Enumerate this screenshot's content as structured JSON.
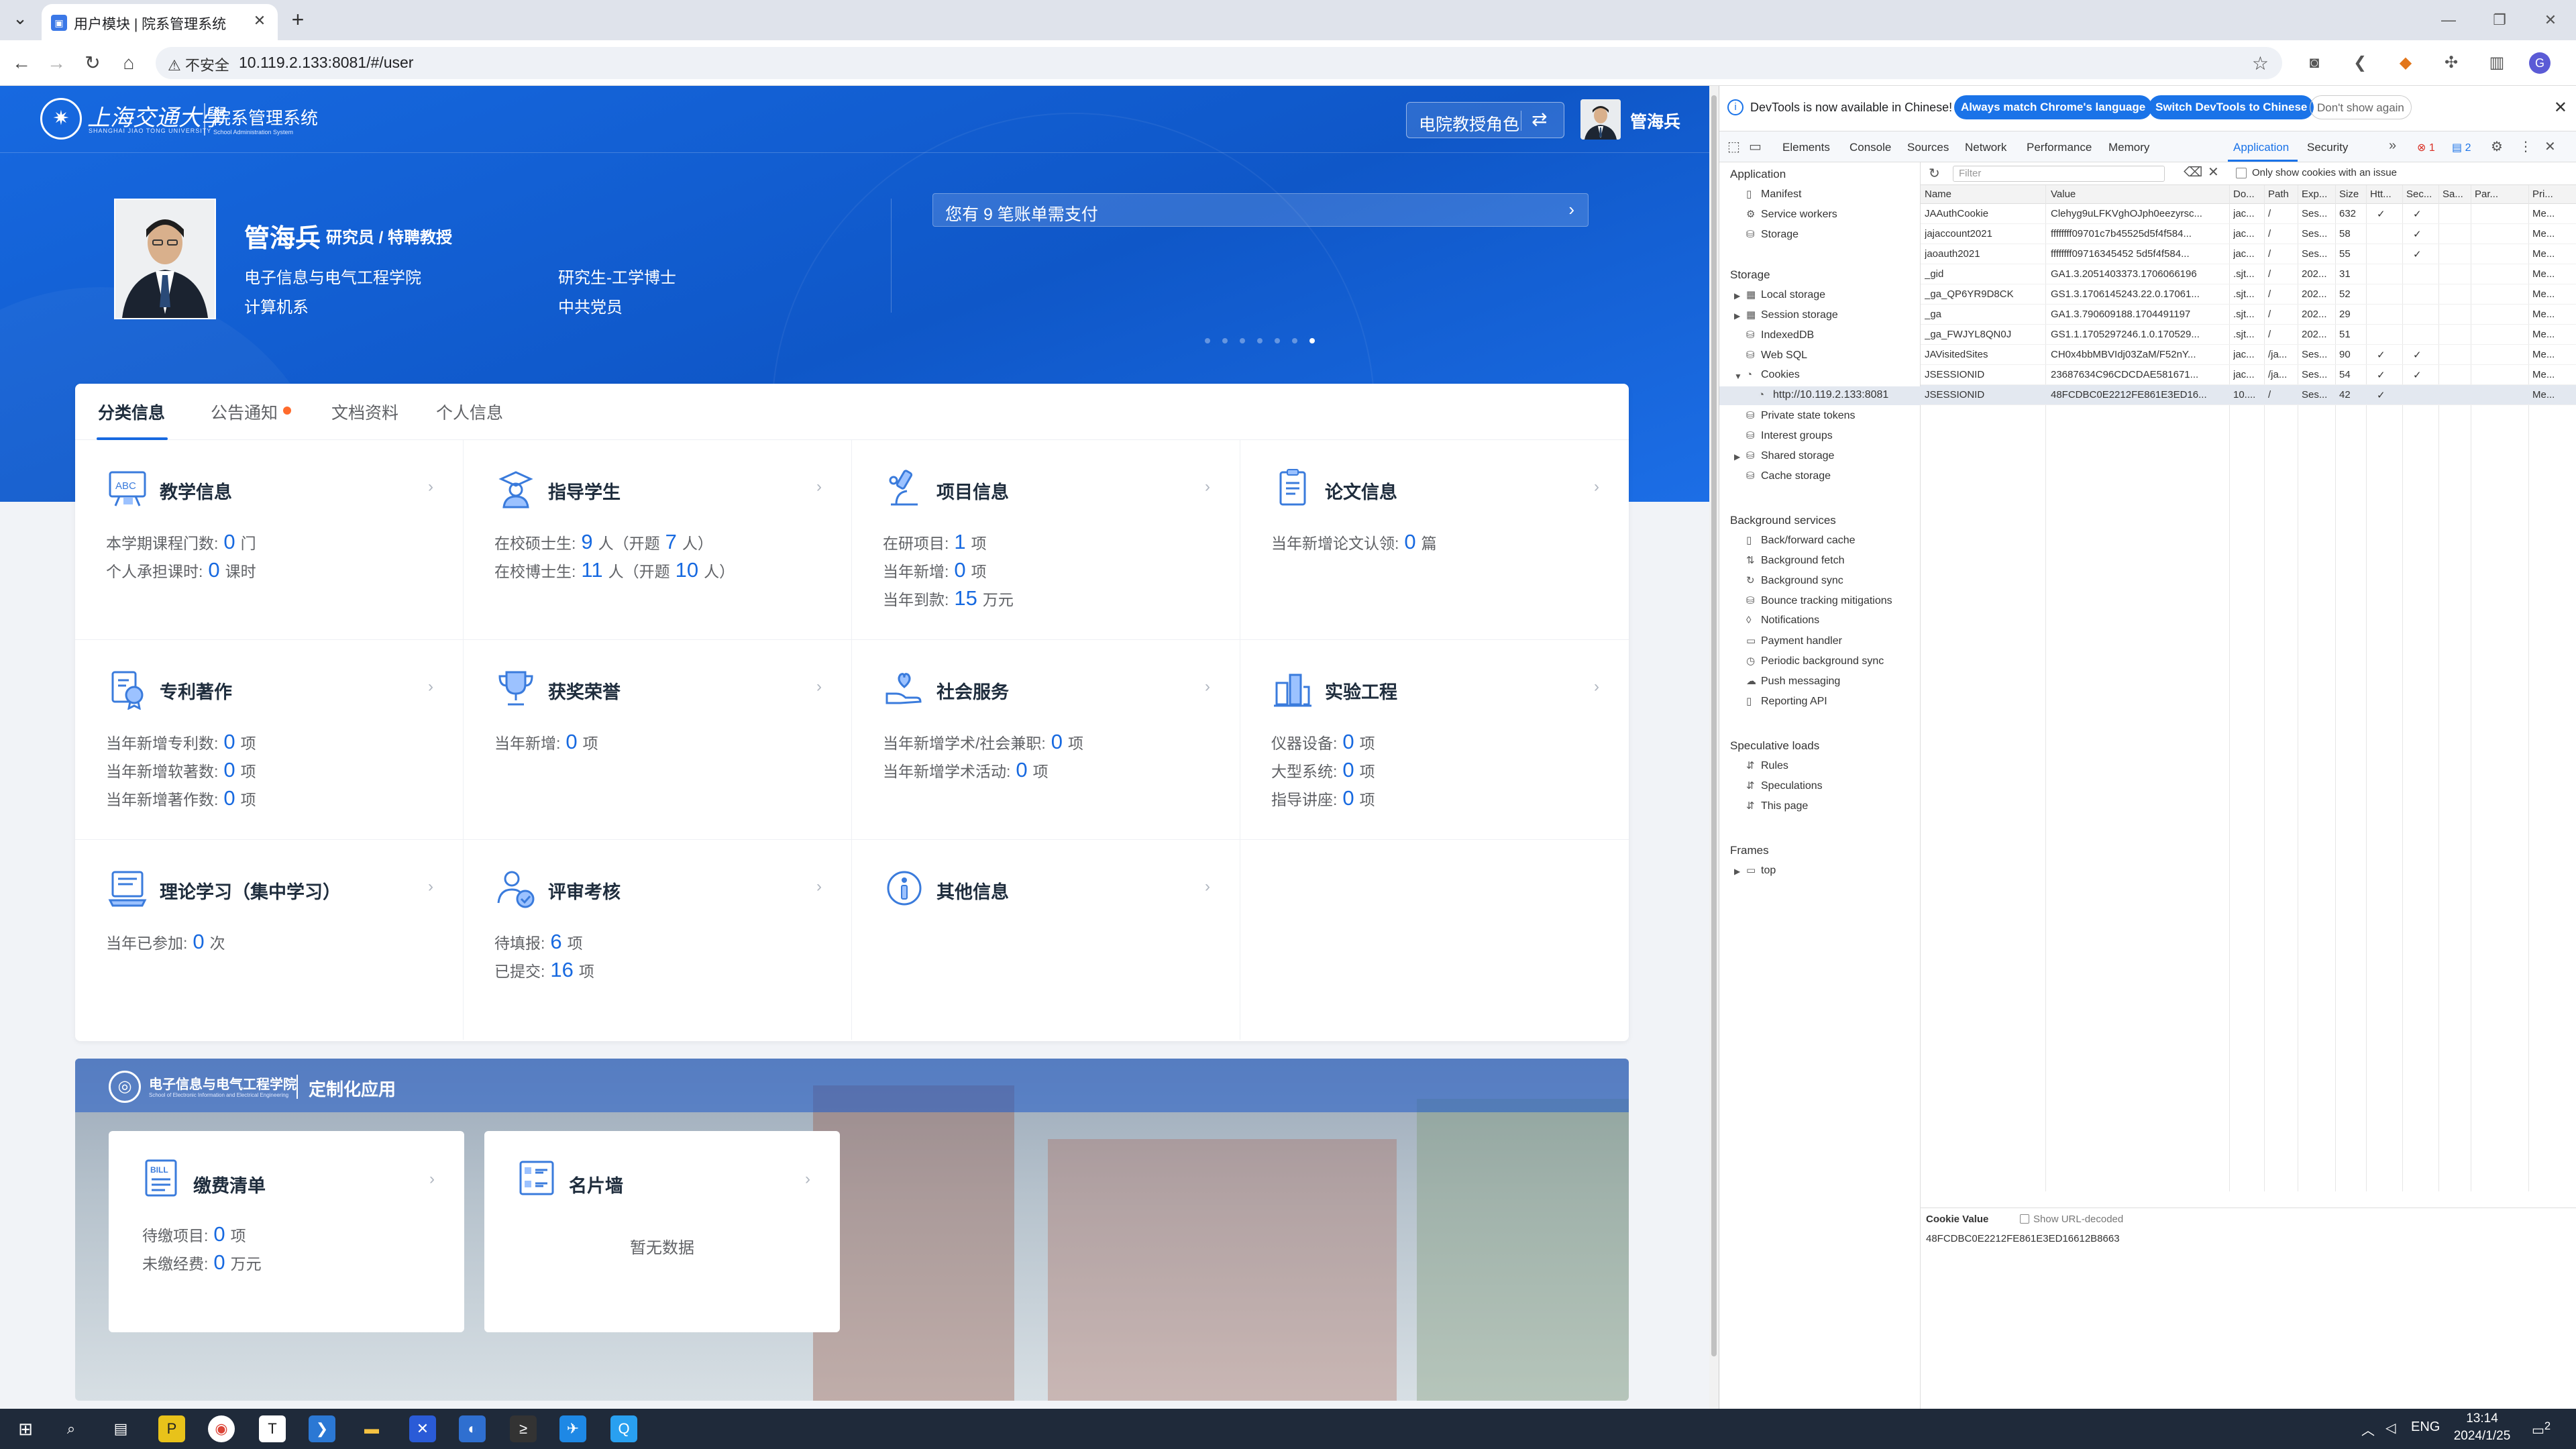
{
  "browser": {
    "tab_title": "用户模块 | 院系管理系统",
    "url": "10.119.2.133:8081/#/user",
    "insecure_label": "不安全"
  },
  "header": {
    "system_title": "院系管理系统",
    "system_subtitle": "School Administration System",
    "university_logo_text": "上海交通大學",
    "university_en": "SHANGHAI JIAO TONG UNIVERSITY",
    "role_button": "电院教授角色",
    "user_name": "管海兵"
  },
  "profile": {
    "name": "管海兵",
    "title": "研究员 / 特聘教授",
    "department": "电子信息与电气工程学院",
    "degree": "研究生-工学博士",
    "major": "计算机系",
    "party": "中共党员"
  },
  "notice": {
    "text": "您有 9 笔账单需支付"
  },
  "tabs": [
    {
      "label": "分类信息"
    },
    {
      "label": "公告通知"
    },
    {
      "label": "文档资料"
    },
    {
      "label": "个人信息"
    }
  ],
  "categories": {
    "teaching": {
      "title": "教学信息",
      "s1_label": "本学期课程门数:",
      "s1_val": "0",
      "s1_unit": "门",
      "s2_label": "个人承担课时:",
      "s2_val": "0",
      "s2_unit": "课时"
    },
    "students": {
      "title": "指导学生",
      "s1_label": "在校硕士生:",
      "s1_val": "9",
      "s1_mid": "人（开题",
      "s1_val2": "7",
      "s1_unit": "人）",
      "s2_label": "在校博士生:",
      "s2_val": "11",
      "s2_mid": "人（开题",
      "s2_val2": "10",
      "s2_unit": "人）"
    },
    "projects": {
      "title": "项目信息",
      "s1_label": "在研项目:",
      "s1_val": "1",
      "s1_unit": "项",
      "s2_label": "当年新增:",
      "s2_val": "0",
      "s2_unit": "项",
      "s3_label": "当年到款:",
      "s3_val": "15",
      "s3_unit": "万元"
    },
    "papers": {
      "title": "论文信息",
      "s1_label": "当年新增论文认领:",
      "s1_val": "0",
      "s1_unit": "篇"
    },
    "patents": {
      "title": "专利著作",
      "s1_label": "当年新增专利数:",
      "s1_val": "0",
      "s1_unit": "项",
      "s2_label": "当年新增软著数:",
      "s2_val": "0",
      "s2_unit": "项",
      "s3_label": "当年新增著作数:",
      "s3_val": "0",
      "s3_unit": "项"
    },
    "awards": {
      "title": "获奖荣誉",
      "s1_label": "当年新增:",
      "s1_val": "0",
      "s1_unit": "项"
    },
    "service": {
      "title": "社会服务",
      "s1_label": "当年新增学术/社会兼职:",
      "s1_val": "0",
      "s1_unit": "项",
      "s2_label": "当年新增学术活动:",
      "s2_val": "0",
      "s2_unit": "项"
    },
    "lab": {
      "title": "实验工程",
      "s1_label": "仪器设备:",
      "s1_val": "0",
      "s1_unit": "项",
      "s2_label": "大型系统:",
      "s2_val": "0",
      "s2_unit": "项",
      "s3_label": "指导讲座:",
      "s3_val": "0",
      "s3_unit": "项"
    },
    "theory": {
      "title": "理论学习（集中学习）",
      "s1_label": "当年已参加:",
      "s1_val": "0",
      "s1_unit": "次"
    },
    "review": {
      "title": "评审考核",
      "s1_label": "待填报:",
      "s1_val": "6",
      "s1_unit": "项",
      "s2_label": "已提交:",
      "s2_val": "16",
      "s2_unit": "项"
    },
    "other": {
      "title": "其他信息"
    }
  },
  "custom_apps": {
    "institute": "电子信息与电气工程学院",
    "institute_en": "School of Electronic Information and Electrical Engineering",
    "title": "定制化应用",
    "bill": {
      "title": "缴费清单",
      "s1_label": "待缴项目:",
      "s1_val": "0",
      "s1_unit": "项",
      "s2_label": "未缴经费:",
      "s2_val": "0",
      "s2_unit": "万元",
      "icon_text": "BILL"
    },
    "cards": {
      "title": "名片墙",
      "empty": "暂无数据"
    }
  },
  "devtools": {
    "info_text": "DevTools is now available in Chinese!",
    "btn_match": "Always match Chrome's language",
    "btn_switch": "Switch DevTools to Chinese",
    "btn_dismiss": "Don't show again",
    "tabs": [
      "Elements",
      "Console",
      "Sources",
      "Network",
      "Performance",
      "Memory",
      "Application",
      "Security"
    ],
    "error_count": "1",
    "msg_count": "2",
    "sidebar": {
      "application": "Application",
      "manifest": "Manifest",
      "service_workers": "Service workers",
      "storage_item": "Storage",
      "storage": "Storage",
      "local_storage": "Local storage",
      "session_storage": "Session storage",
      "indexeddb": "IndexedDB",
      "websql": "Web SQL",
      "cookies": "Cookies",
      "cookie_origin": "http://10.119.2.133:8081",
      "private_state": "Private state tokens",
      "interest_groups": "Interest groups",
      "shared_storage": "Shared storage",
      "cache_storage": "Cache storage",
      "background": "Background services",
      "bfcache": "Back/forward cache",
      "bg_fetch": "Background fetch",
      "bg_sync": "Background sync",
      "bounce": "Bounce tracking mitigations",
      "notifications": "Notifications",
      "payment": "Payment handler",
      "periodic_sync": "Periodic background sync",
      "push": "Push messaging",
      "reporting": "Reporting API",
      "speculative": "Speculative loads",
      "rules": "Rules",
      "speculations": "Speculations",
      "this_page": "This page",
      "frames": "Frames",
      "top": "top"
    },
    "filter_placeholder": "Filter",
    "only_issue": "Only show cookies with an issue",
    "columns": [
      "Name",
      "Value",
      "Do...",
      "Path",
      "Exp...",
      "Size",
      "Htt...",
      "Sec...",
      "Sa...",
      "Par...",
      "Pri..."
    ],
    "cookies": [
      {
        "name": "JAAuthCookie",
        "value": "Clehyg9uLFKVghOJph0eezyrsc...",
        "domain": "jac...",
        "path": "/",
        "exp": "Ses...",
        "size": "632",
        "http": "✓",
        "sec": "✓",
        "pri": "Me..."
      },
      {
        "name": "jajaccount2021",
        "value": "ffffffff09701c7b45525d5f4f584...",
        "domain": "jac...",
        "path": "/",
        "exp": "Ses...",
        "size": "58",
        "http": "",
        "sec": "✓",
        "pri": "Me..."
      },
      {
        "name": "jaoauth2021",
        "value": "ffffffff09716345452 5d5f4f584...",
        "domain": "jac...",
        "path": "/",
        "exp": "Ses...",
        "size": "55",
        "http": "",
        "sec": "✓",
        "pri": "Me..."
      },
      {
        "name": "_gid",
        "value": "GA1.3.2051403373.1706066196",
        "domain": ".sjt...",
        "path": "/",
        "exp": "202...",
        "size": "31",
        "http": "",
        "sec": "",
        "pri": "Me..."
      },
      {
        "name": "_ga_QP6YR9D8CK",
        "value": "GS1.3.1706145243.22.0.17061...",
        "domain": ".sjt...",
        "path": "/",
        "exp": "202...",
        "size": "52",
        "http": "",
        "sec": "",
        "pri": "Me..."
      },
      {
        "name": "_ga",
        "value": "GA1.3.790609188.1704491197",
        "domain": ".sjt...",
        "path": "/",
        "exp": "202...",
        "size": "29",
        "http": "",
        "sec": "",
        "pri": "Me..."
      },
      {
        "name": "_ga_FWJYL8QN0J",
        "value": "GS1.1.1705297246.1.0.170529...",
        "domain": ".sjt...",
        "path": "/",
        "exp": "202...",
        "size": "51",
        "http": "",
        "sec": "",
        "pri": "Me..."
      },
      {
        "name": "JAVisitedSites",
        "value": "CH0x4bbMBVIdj03ZaM/F52nY...",
        "domain": "jac...",
        "path": "/ja...",
        "exp": "Ses...",
        "size": "90",
        "http": "✓",
        "sec": "✓",
        "pri": "Me..."
      },
      {
        "name": "JSESSIONID",
        "value": "23687634C96CDCDAE581671...",
        "domain": "jac...",
        "path": "/ja...",
        "exp": "Ses...",
        "size": "54",
        "http": "✓",
        "sec": "✓",
        "pri": "Me..."
      },
      {
        "name": "JSESSIONID",
        "value": "48FCDBC0E2212FE861E3ED16...",
        "domain": "10....",
        "path": "/",
        "exp": "Ses...",
        "size": "42",
        "http": "✓",
        "sec": "",
        "pri": "Me..."
      }
    ],
    "cookie_value_label": "Cookie Value",
    "show_url_decoded": "Show URL-decoded",
    "cookie_value": "48FCDBC0E2212FE861E3ED16612B8663"
  },
  "taskbar": {
    "lang": "ENG",
    "time": "13:14",
    "date": "2024/1/25",
    "notif_count": "2"
  },
  "colors": {
    "accent": "#1769e0",
    "devtools_blue": "#1a73e8"
  }
}
